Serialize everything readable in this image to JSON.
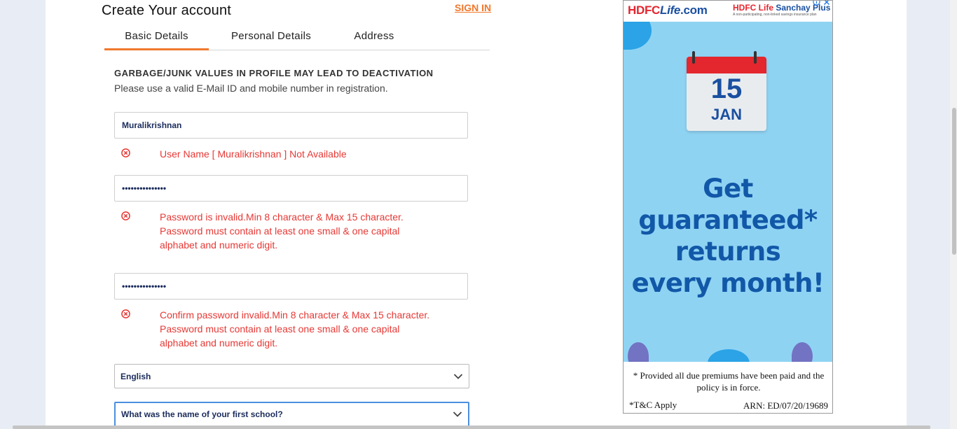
{
  "form": {
    "title": "Create Your account",
    "signin_label": "SIGN IN",
    "tabs": [
      {
        "label": "Basic Details",
        "active": true
      },
      {
        "label": "Personal Details",
        "active": false
      },
      {
        "label": "Address",
        "active": false
      }
    ],
    "warning_heading": "GARBAGE/JUNK VALUES IN PROFILE MAY LEAD TO DEACTIVATION",
    "warning_sub": "Please use a valid E-Mail ID and mobile number in registration.",
    "username_value": "Muralikrishnan",
    "username_error": "User Name [ Muralikrishnan ] Not Available",
    "password_value": "•••••••••••••••",
    "password_error": "Password is invalid.Min 8 character & Max 15 character.\nPassword must contain at least one small & one capital\nalphabet and numeric digit.",
    "confirm_value": "•••••••••••••••",
    "confirm_error": "Confirm password invalid.Min 8 character & Max 15 character.\nPassword must contain at least one small & one capital\nalphabet and numeric digit.",
    "language_selected": "English",
    "security_question_selected": "What was the name of your first school?"
  },
  "ad": {
    "logo_hdfc": "HDFC",
    "logo_life": "Life",
    "logo_com": ".com",
    "brand_a": "HDFC Life",
    "brand_b": "Sanchay Plus",
    "brand_sub": "A non-participating, non-linked savings insurance plan",
    "cal_day": "15",
    "cal_month": "JAN",
    "headline_1": "Get",
    "headline_2": "guaranteed*",
    "headline_3": "returns",
    "headline_4": "every month!",
    "footnote": "* Provided all due premiums have been paid and the policy is in force.",
    "tnc": "*T&C Apply",
    "arn": "ARN: ED/07/20/19689",
    "close_icon": "close-icon",
    "info_icon": "info-icon"
  },
  "colors": {
    "accent": "#f0782d",
    "error": "#e53935",
    "ad_blue": "#8fd3f3",
    "ad_text": "#1258a8"
  }
}
